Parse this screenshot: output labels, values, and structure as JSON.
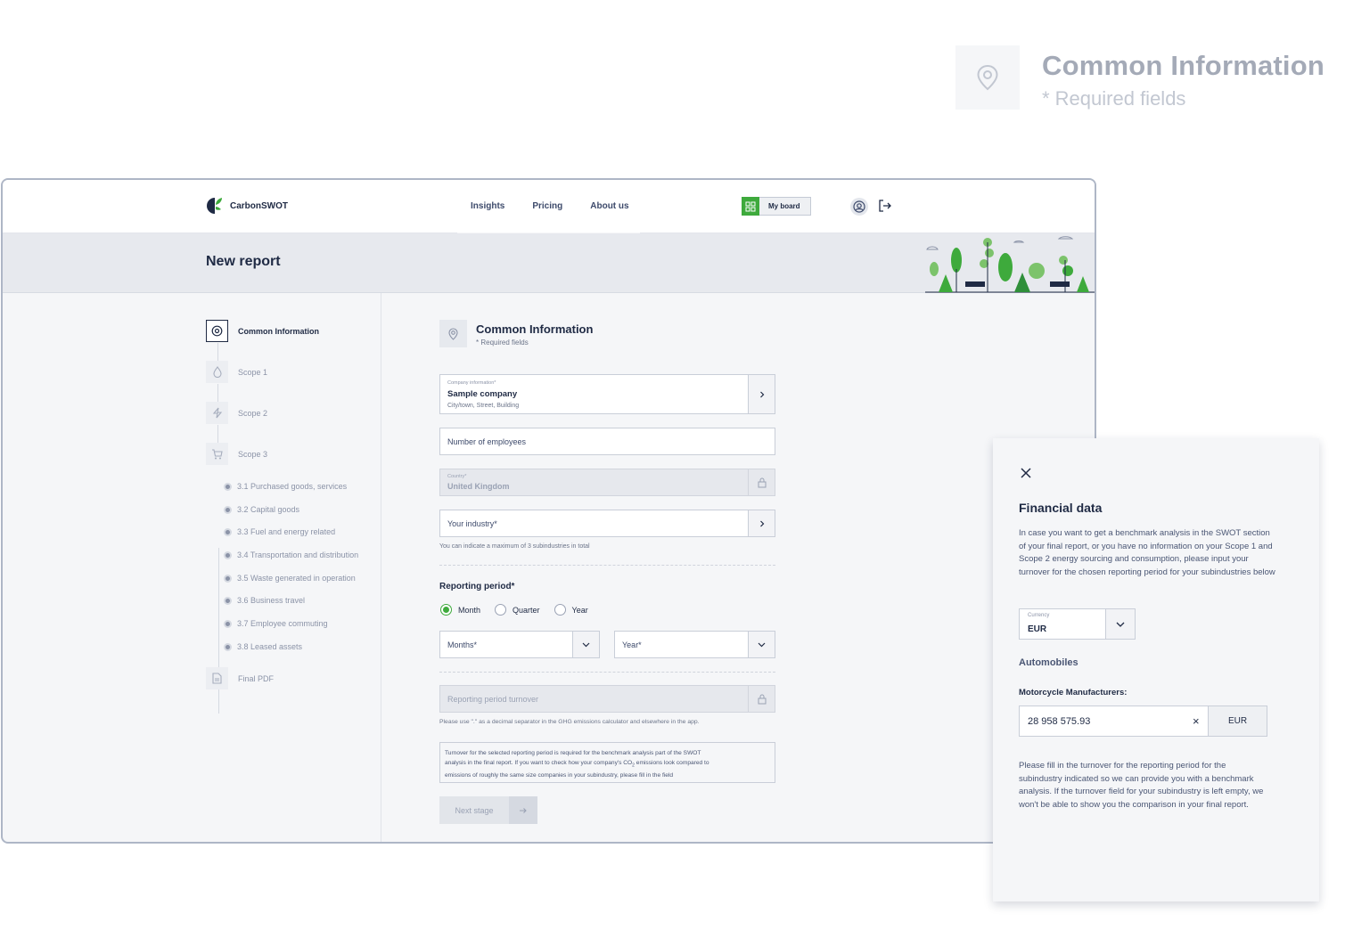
{
  "hero": {
    "title": "Common Information",
    "subtitle": "* Required fields"
  },
  "nav": {
    "brand": "CarbonSWOT",
    "links": [
      "Insights",
      "Pricing",
      "About us"
    ],
    "board_button": "My board"
  },
  "banner": {
    "title": "New report"
  },
  "steps": {
    "items": [
      "Common Information",
      "Scope 1",
      "Scope 2",
      "Scope 3",
      "Final PDF"
    ],
    "scope3_subitems": [
      "3.1 Purchased goods, services",
      "3.2 Capital goods",
      "3.3 Fuel and energy related",
      "3.4 Transportation and distribution",
      "3.5 Waste generated in operation",
      "3.6 Business travel",
      "3.7 Employee commuting",
      "3.8 Leased assets"
    ]
  },
  "form": {
    "title": "Common Information",
    "subtitle": "* Required fields",
    "company": {
      "label": "Company information*",
      "value": "Sample company",
      "address": "City/town, Street, Building"
    },
    "employees_placeholder": "Number of employees",
    "country": {
      "label": "Country*",
      "value": "United Kingdom"
    },
    "industry_placeholder": "Your industry*",
    "industry_hint": "You can indicate a maximum of 3 subindustries in total",
    "reporting_title": "Reporting period*",
    "period_options": [
      "Month",
      "Quarter",
      "Year"
    ],
    "period_selected": "Month",
    "months_placeholder": "Months*",
    "year_placeholder": "Year*",
    "turnover_placeholder": "Reporting period turnover",
    "decimal_hint": "Please use \".\" as a decimal separator in the GHG emissions calculator and elsewhere in the app.",
    "info_line1": "Turnover for the selected reporting period is required for the benchmark analysis part of the SWOT",
    "info_line2": "analysis in the final report. If you want to check how your company's CO",
    "info_line2_sub": "2",
    "info_line2_end": " emissions look compared to",
    "info_line3": "emissions of roughly the same size companies in your subindustry, please fill in the field",
    "next_button": "Next stage"
  },
  "panel": {
    "title": "Financial data",
    "description": "In case you want to get a benchmark analysis in the SWOT section of your final report, or you have no information on your Scope 1 and Scope 2 energy sourcing and consumption, please input your turnover for the chosen reporting period for your subindustries below",
    "currency_label": "Currency",
    "currency_value": "EUR",
    "industry": "Automobiles",
    "subindustry": "Motorcycle Manufacturers:",
    "turnover_value": "28 958 575.93",
    "turnover_currency": "EUR",
    "footer_text": "Please fill in the turnover for the reporting period for the subindustry indicated so we can provide you with a benchmark analysis.  If the turnover field for your subindustry is left empty, we won't be able to show you the comparison in your final report."
  },
  "colors": {
    "accent": "#3eaa3c",
    "navy": "#1f2a44",
    "muted": "#8b93a7"
  }
}
